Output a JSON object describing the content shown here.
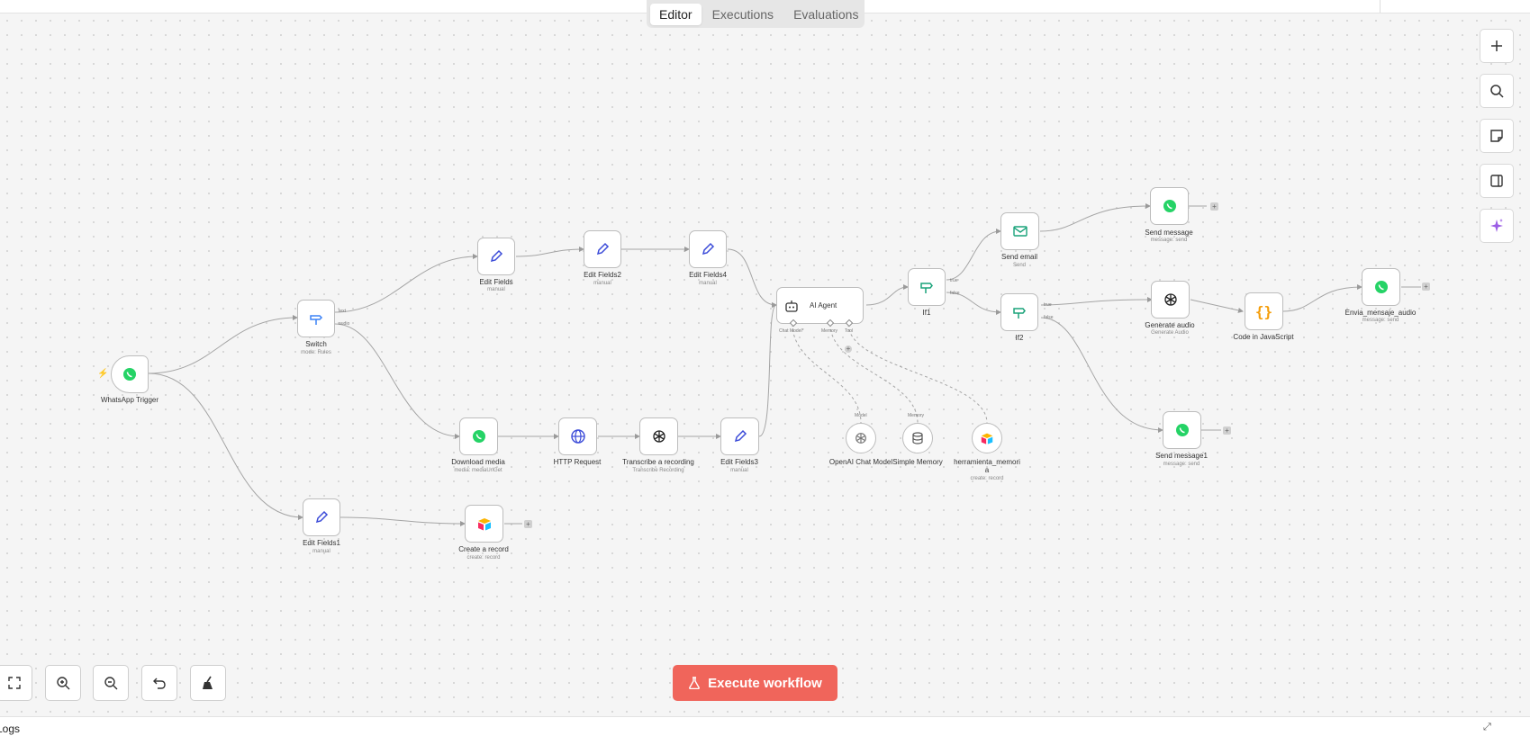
{
  "tabs": [
    {
      "label": "Editor"
    },
    {
      "label": "Executions"
    },
    {
      "label": "Evaluations"
    }
  ],
  "nodes": {
    "whatsapp_trigger": {
      "label": "WhatsApp Trigger",
      "icon": "whatsapp-icon"
    },
    "switch": {
      "label": "Switch",
      "sub": "mode: Rules",
      "outputs": [
        "text",
        "audio"
      ],
      "icon": "switch-icon"
    },
    "edit_fields": {
      "label": "Edit Fields",
      "sub": "manual",
      "icon": "pencil-icon"
    },
    "edit_fields2": {
      "label": "Edit Fields2",
      "sub": "manual",
      "icon": "pencil-icon"
    },
    "edit_fields4": {
      "label": "Edit Fields4",
      "sub": "manual",
      "icon": "pencil-icon"
    },
    "download_media": {
      "label": "Download media",
      "sub": "media: mediaUrlGet",
      "icon": "whatsapp-icon"
    },
    "http_request": {
      "label": "HTTP Request",
      "icon": "globe-icon"
    },
    "transcribe": {
      "label": "Transcribe a recording",
      "sub": "Transcribe Recording",
      "icon": "openai-icon"
    },
    "edit_fields3": {
      "label": "Edit Fields3",
      "sub": "manual",
      "icon": "pencil-icon"
    },
    "edit_fields1": {
      "label": "Edit Fields1",
      "sub": "manual",
      "icon": "pencil-icon"
    },
    "create_record": {
      "label": "Create a record",
      "sub": "create: record",
      "icon": "airtable-icon"
    },
    "ai_agent": {
      "label": "AI Agent",
      "ports": [
        "Chat Model*",
        "Memory",
        "Tool"
      ],
      "icon": "robot-icon"
    },
    "openai_chat_model": {
      "label": "OpenAI Chat Model",
      "port": "Model",
      "icon": "openai-icon"
    },
    "simple_memory": {
      "label": "Simple Memory",
      "port": "Memory",
      "icon": "database-icon"
    },
    "herramienta": {
      "label": "herramienta_memori a",
      "sub": "create: record",
      "icon": "airtable-icon"
    },
    "if1": {
      "label": "If1",
      "outputs": [
        "true",
        "false"
      ],
      "icon": "if-icon"
    },
    "if2": {
      "label": "If2",
      "outputs": [
        "true",
        "false"
      ],
      "icon": "if-icon"
    },
    "send_email": {
      "label": "Send email",
      "sub": "Send",
      "icon": "mail-icon"
    },
    "send_message": {
      "label": "Send message",
      "sub": "message: send",
      "icon": "whatsapp-icon"
    },
    "generate_audio": {
      "label": "Generate audio",
      "sub": "Generate Audio",
      "icon": "openai-icon"
    },
    "code_js": {
      "label": "Code in JavaScript",
      "icon": "code-braces-icon"
    },
    "envia_audio": {
      "label": "Envia_mensaje_audio",
      "sub": "message: send",
      "icon": "whatsapp-icon"
    },
    "send_message1": {
      "label": "Send message1",
      "sub": "message: send",
      "icon": "whatsapp-icon"
    }
  },
  "right_toolbar": [
    "plus-icon",
    "search-icon",
    "sticky-note-icon",
    "panel-icon",
    "sparkle-icon"
  ],
  "bottom_toolbar": [
    "fit-view-icon",
    "zoom-in-icon",
    "zoom-out-icon",
    "undo-icon",
    "tidy-up-icon"
  ],
  "execute_button": {
    "label": "Execute workflow",
    "icon": "flask-icon"
  },
  "logs": {
    "label": "Logs"
  },
  "colors": {
    "execute": "#f0655b",
    "whatsapp": "#25d366",
    "pencil": "#3b4bd8",
    "ai": "#9b5de5",
    "mail": "#1aa37a"
  }
}
